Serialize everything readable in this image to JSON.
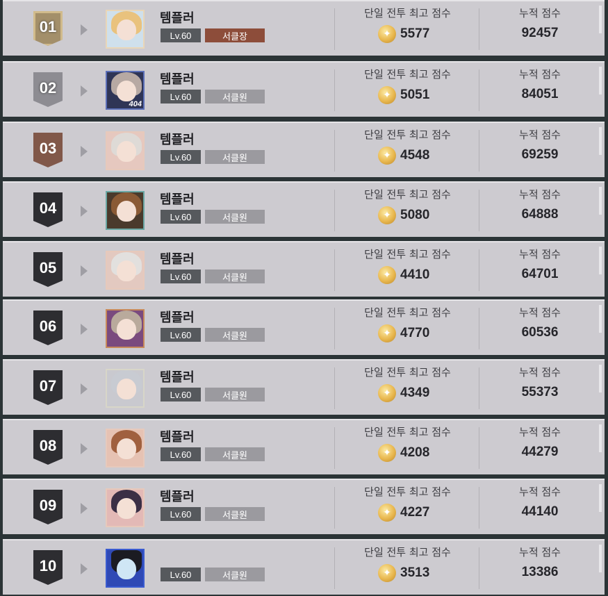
{
  "labels": {
    "best_score": "단일 전투 최고 점수",
    "total_score": "누적 점수"
  },
  "colors": {
    "leader_badge": "#8d4d3a",
    "member_badge": "#9b9a9f",
    "rank_gold": "#a38f6a",
    "rank_silver": "#8d8c92",
    "rank_bronze": "#815849",
    "rank_dark": "#2d2d31"
  },
  "rows": [
    {
      "rank": "01",
      "name": "템플러",
      "level": "Lv.60",
      "role": "서클장",
      "best": "5577",
      "total": "92457",
      "avatar_icon": "portrait-blonde-maid-icon"
    },
    {
      "rank": "02",
      "name": "템플러",
      "level": "Lv.60",
      "role": "서클원",
      "best": "5051",
      "total": "84051",
      "avatar_icon": "portrait-404-silver-hair-icon",
      "avatar_tag": "404"
    },
    {
      "rank": "03",
      "name": "템플러",
      "level": "Lv.60",
      "role": "서클원",
      "best": "4548",
      "total": "69259",
      "avatar_icon": "portrait-white-hair-icon"
    },
    {
      "rank": "04",
      "name": "템플러",
      "level": "Lv.60",
      "role": "서클원",
      "best": "5080",
      "total": "64888",
      "avatar_icon": "portrait-brown-hair-icon"
    },
    {
      "rank": "05",
      "name": "템플러",
      "level": "Lv.60",
      "role": "서클원",
      "best": "4410",
      "total": "64701",
      "avatar_icon": "portrait-white-hair-icon"
    },
    {
      "rank": "06",
      "name": "템플러",
      "level": "Lv.60",
      "role": "서클원",
      "best": "4770",
      "total": "60536",
      "avatar_icon": "portrait-ash-hair-icon"
    },
    {
      "rank": "07",
      "name": "템플러",
      "level": "Lv.60",
      "role": "서클원",
      "best": "4349",
      "total": "55373",
      "avatar_icon": "portrait-silver-hair-icon"
    },
    {
      "rank": "08",
      "name": "템플러",
      "level": "Lv.60",
      "role": "서클원",
      "best": "4208",
      "total": "44279",
      "avatar_icon": "portrait-auburn-hair-icon"
    },
    {
      "rank": "09",
      "name": "템플러",
      "level": "Lv.60",
      "role": "서클원",
      "best": "4227",
      "total": "44140",
      "avatar_icon": "portrait-dark-hair-hat-icon"
    },
    {
      "rank": "10",
      "name": "",
      "level": "Lv.60",
      "role": "서클원",
      "best": "3513",
      "total": "13386",
      "avatar_icon": "portrait-blue-hat-icon"
    }
  ]
}
